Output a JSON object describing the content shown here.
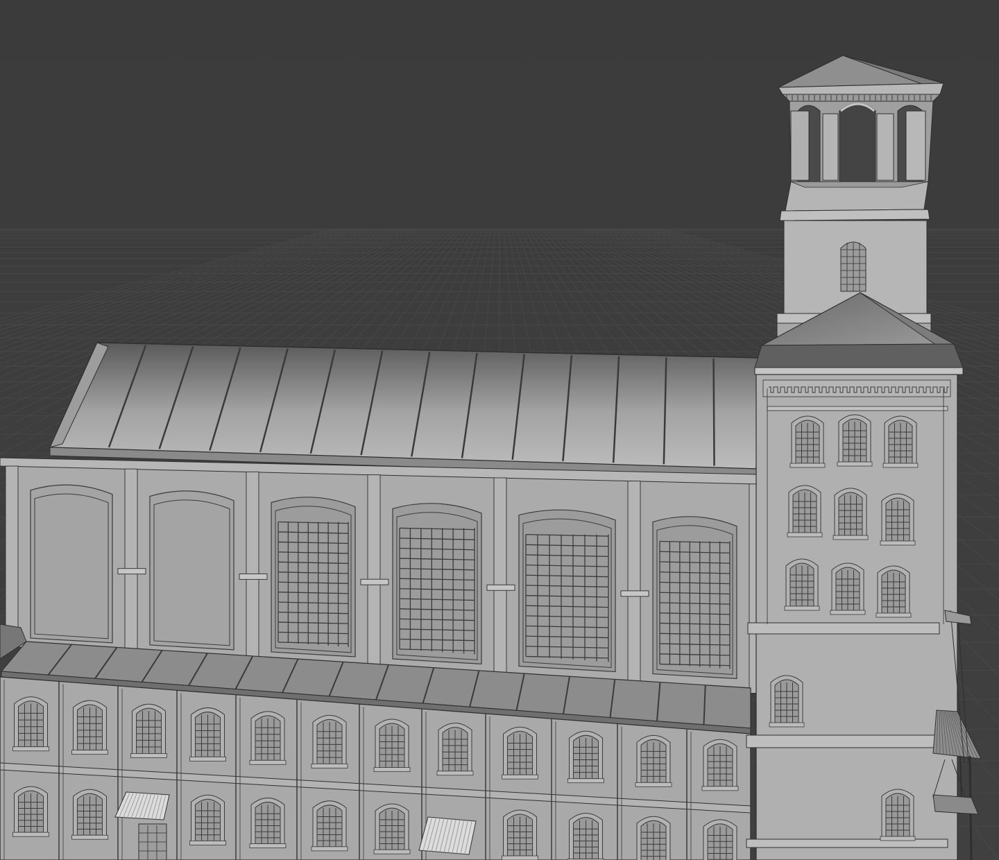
{
  "app": {
    "view": "3d-viewport",
    "colors": {
      "background": "#3d3d3d",
      "grid": "#474747",
      "wall": "#a9a9a9",
      "wall_light": "#b4b4b4",
      "wall_dark": "#8e8e8e",
      "edge": "#3a3a3a",
      "roof_top": "#5c5c5c",
      "roof_bottom": "#b8b8b8"
    }
  },
  "scene": {
    "object": "mill-building-with-bell-tower",
    "shading": "solid",
    "wireframe_overlay": true
  }
}
